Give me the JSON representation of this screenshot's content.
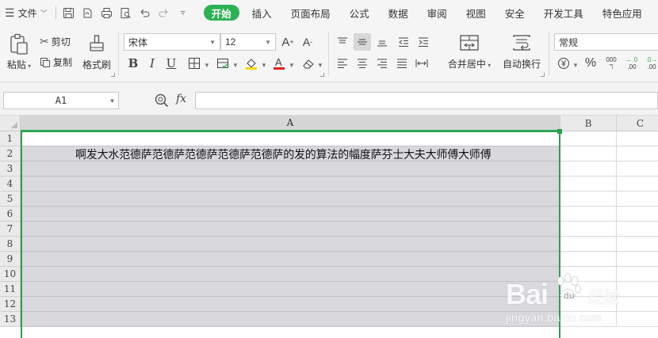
{
  "menubar": {
    "file_label": "文件",
    "tabs": [
      "开始",
      "插入",
      "页面布局",
      "公式",
      "数据",
      "审阅",
      "视图",
      "安全",
      "开发工具",
      "特色应用"
    ],
    "active_tab": "开始",
    "accent_color": "#2db155"
  },
  "ribbon": {
    "paste_label": "粘贴",
    "cut_label": "剪切",
    "copy_label": "复制",
    "format_painter_label": "格式刷",
    "font_name": "宋体",
    "font_size": "12",
    "merge_center_label": "合并居中",
    "wrap_text_label": "自动换行",
    "number_format": "常规",
    "decimal_inc_label": ".00",
    "decimal_dec_label": ".00",
    "thousands_label": "000",
    "font_color": "#e02020",
    "fill_color": "#f5d600"
  },
  "formula_bar": {
    "name_box": "A1",
    "fx_label": "fx",
    "formula": ""
  },
  "sheet": {
    "columns": [
      "A",
      "B",
      "C"
    ],
    "rows": [
      "1",
      "2",
      "3",
      "4",
      "5",
      "6",
      "7",
      "8",
      "9",
      "10",
      "11",
      "12",
      "13"
    ],
    "selected_column": "A",
    "active_cell": "A1",
    "cell_a2": "啊发大水范德萨范德萨范德萨范德萨范德萨的发的算法的幅度萨芬士大夫大师傅大师傅"
  },
  "watermark": {
    "brand": "Bai",
    "brand_suffix": "经验",
    "url": "jingyan.baidu.com"
  }
}
